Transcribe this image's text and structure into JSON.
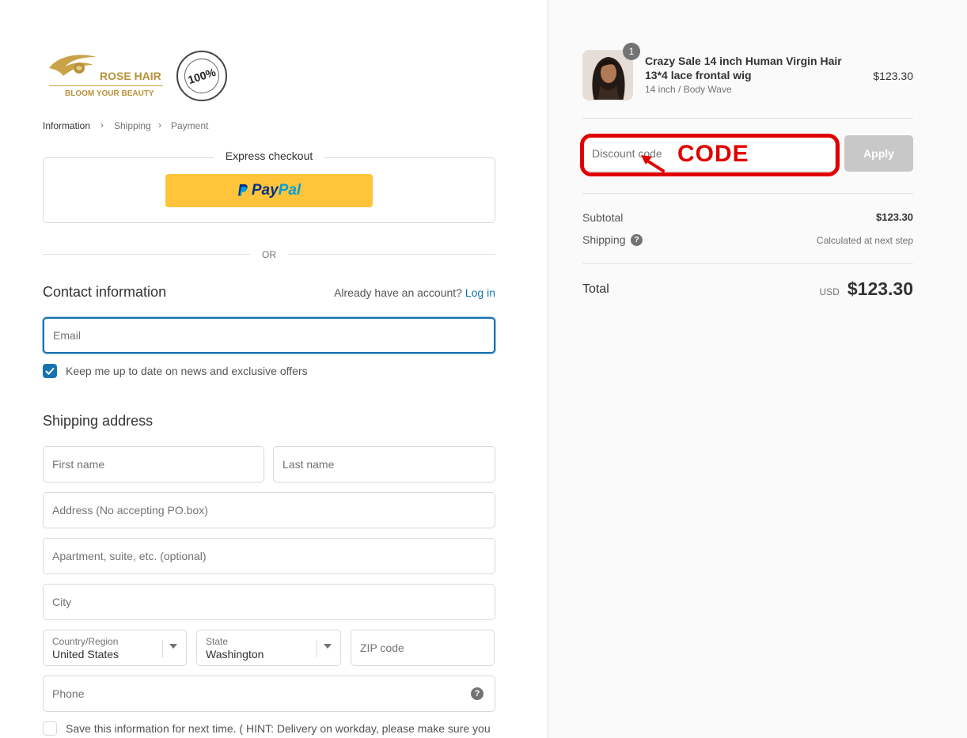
{
  "brand": {
    "name": "ROSE HAIR",
    "tagline": "BLOOM YOUR BEAUTY",
    "seal": {
      "center": "100%",
      "ring": "Natural Hair • Natural Hair • Natural Hair"
    }
  },
  "breadcrumb": [
    "Information",
    "Shipping",
    "Payment"
  ],
  "express": {
    "title": "Express checkout",
    "paypal_dark": "Pay",
    "paypal_light": "Pal"
  },
  "or_label": "OR",
  "contact": {
    "heading": "Contact information",
    "account_prompt": "Already have an account?",
    "login_link": "Log in",
    "email_placeholder": "Email",
    "newsletter_label": "Keep me up to date on news and exclusive offers"
  },
  "shipping": {
    "heading": "Shipping address",
    "first_name_placeholder": "First name",
    "last_name_placeholder": "Last name",
    "address_placeholder": "Address (No accepting PO.box)",
    "apartment_placeholder": "Apartment, suite, etc. (optional)",
    "city_placeholder": "City",
    "country_label": "Country/Region",
    "country_value": "United States",
    "state_label": "State",
    "state_value": "Washington",
    "zip_placeholder": "ZIP code",
    "phone_placeholder": "Phone",
    "save_info_label": "Save this information for next time. ( HINT: Delivery on workday, please make sure you"
  },
  "order": {
    "quantity": "1",
    "product_title": "Crazy Sale 14 inch Human Virgin Hair 13*4 lace frontal wig",
    "variant": "14 inch / Body Wave",
    "price": "$123.30",
    "discount_placeholder": "Discount code",
    "apply_label": "Apply",
    "annotation": "CODE",
    "subtotal_label": "Subtotal",
    "subtotal_value": "$123.30",
    "shipping_label": "Shipping",
    "shipping_value": "Calculated at next step",
    "total_label": "Total",
    "currency": "USD",
    "total_value": "$123.30"
  },
  "colors": {
    "accent": "#1773b0",
    "paypal": "#ffc439",
    "brand_gold": "#b8923a",
    "annotation_red": "#e00000"
  }
}
